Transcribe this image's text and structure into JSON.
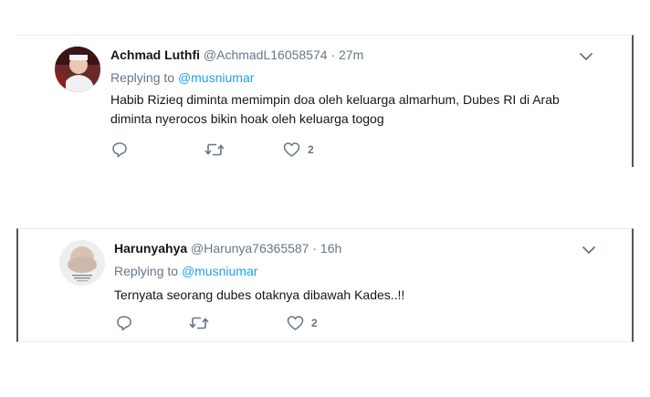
{
  "tweets": [
    {
      "display_name": "Achmad Luthfi",
      "handle": "@AchmadL16058574",
      "time": "27m",
      "replying_label": "Replying to",
      "replying_to": "@musniumar",
      "text": "Habib Rizieq diminta memimpin doa oleh keluarga almarhum, Dubes RI di Arab diminta nyerocos bikin hoak oleh keluarga togog",
      "like_count": "2"
    },
    {
      "display_name": "Harunyahya",
      "handle": "@Harunya76365587",
      "time": "16h",
      "replying_label": "Replying to",
      "replying_to": "@musniumar",
      "text": "Ternyata seorang dubes otaknya dibawah Kades..!!",
      "like_count": "2"
    }
  ],
  "separator": " · ",
  "icons": {
    "reply": "reply-icon",
    "retweet": "retweet-icon",
    "like": "heart-icon",
    "menu": "chevron-down-icon"
  },
  "colors": {
    "link": "#1da1f2",
    "meta": "#657786",
    "text": "#14171a"
  }
}
